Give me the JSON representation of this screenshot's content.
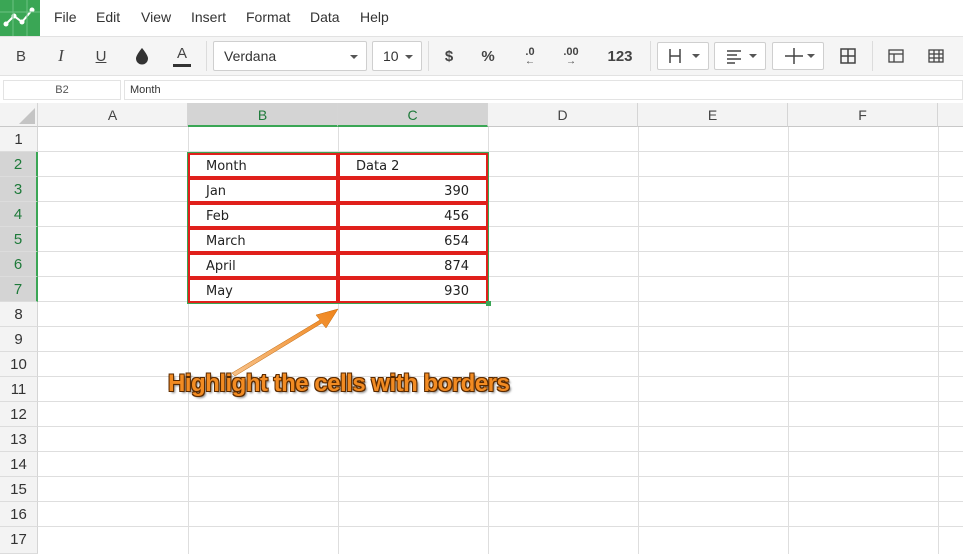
{
  "menu": {
    "items": [
      "File",
      "Edit",
      "View",
      "Insert",
      "Format",
      "Data",
      "Help"
    ]
  },
  "toolbar": {
    "bold": "B",
    "italic": "I",
    "underline": "U",
    "font_color": "A",
    "font_name": "Verdana",
    "font_size": "10",
    "currency": "$",
    "percent": "%",
    "decrease_decimals": ".0",
    "increase_decimals": ".00",
    "number_format": "123"
  },
  "formula_bar": {
    "cell_ref": "B2",
    "value": "Month"
  },
  "columns": [
    "A",
    "B",
    "C",
    "D",
    "E",
    "F"
  ],
  "rows": [
    "1",
    "2",
    "3",
    "4",
    "5",
    "6",
    "7",
    "8",
    "9",
    "10",
    "11",
    "12",
    "13",
    "14",
    "15",
    "16",
    "17"
  ],
  "table": {
    "header": [
      "Month",
      "Data 2"
    ],
    "rows": [
      [
        "Jan",
        "390"
      ],
      [
        "Feb",
        "456"
      ],
      [
        "March",
        "654"
      ],
      [
        "April",
        "874"
      ],
      [
        "May",
        "930"
      ]
    ]
  },
  "annotation": {
    "text": "Highlight the cells with borders",
    "color": "#f28b22"
  },
  "colors": {
    "brand": "#3aa655",
    "border_highlight": "#e0201b",
    "selection": "#3aa655"
  }
}
